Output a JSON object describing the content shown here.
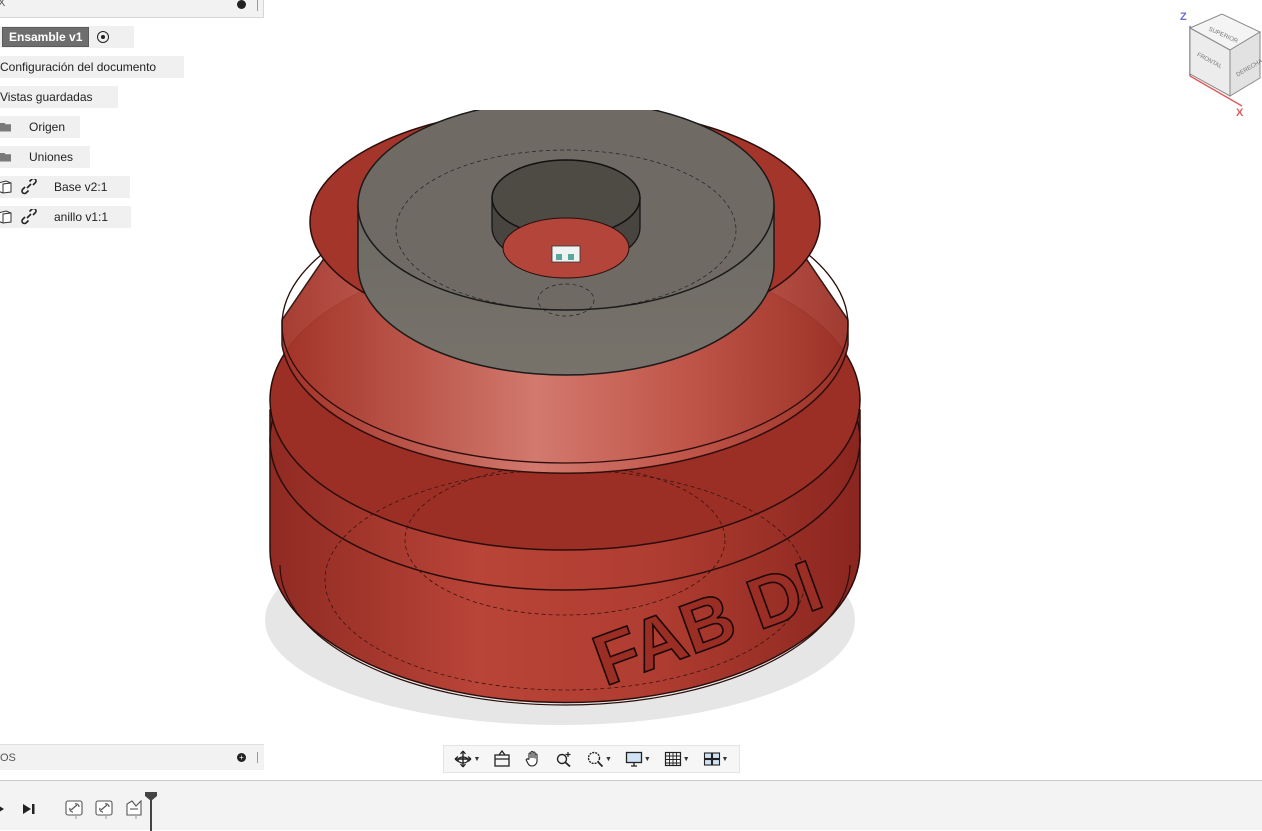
{
  "browser": {
    "header_label": "X",
    "root": {
      "label": "Ensamble v1"
    },
    "items": [
      {
        "label": "Configuración del documento"
      },
      {
        "label": "Vistas guardadas"
      },
      {
        "label": "Origen",
        "icon": "folder-icon"
      },
      {
        "label": "Uniones",
        "icon": "folder-icon"
      },
      {
        "label": "Base v2:1",
        "icon": "component-icon"
      },
      {
        "label": "anillo v1:1",
        "icon": "component-icon"
      }
    ]
  },
  "comments": {
    "label": "OS"
  },
  "model": {
    "text": "FAB DI"
  },
  "viewcube": {
    "axis_z": "Z",
    "axis_x": "X",
    "face_top": "SUPERIOR",
    "face_front": "FRONTAL",
    "face_right": "DERECHA"
  },
  "colors": {
    "model_red": "#a8352b",
    "ring_gray": "#6f6b64",
    "panel_bg": "#f2f2f2",
    "root_badge": "#6e6e6e"
  }
}
